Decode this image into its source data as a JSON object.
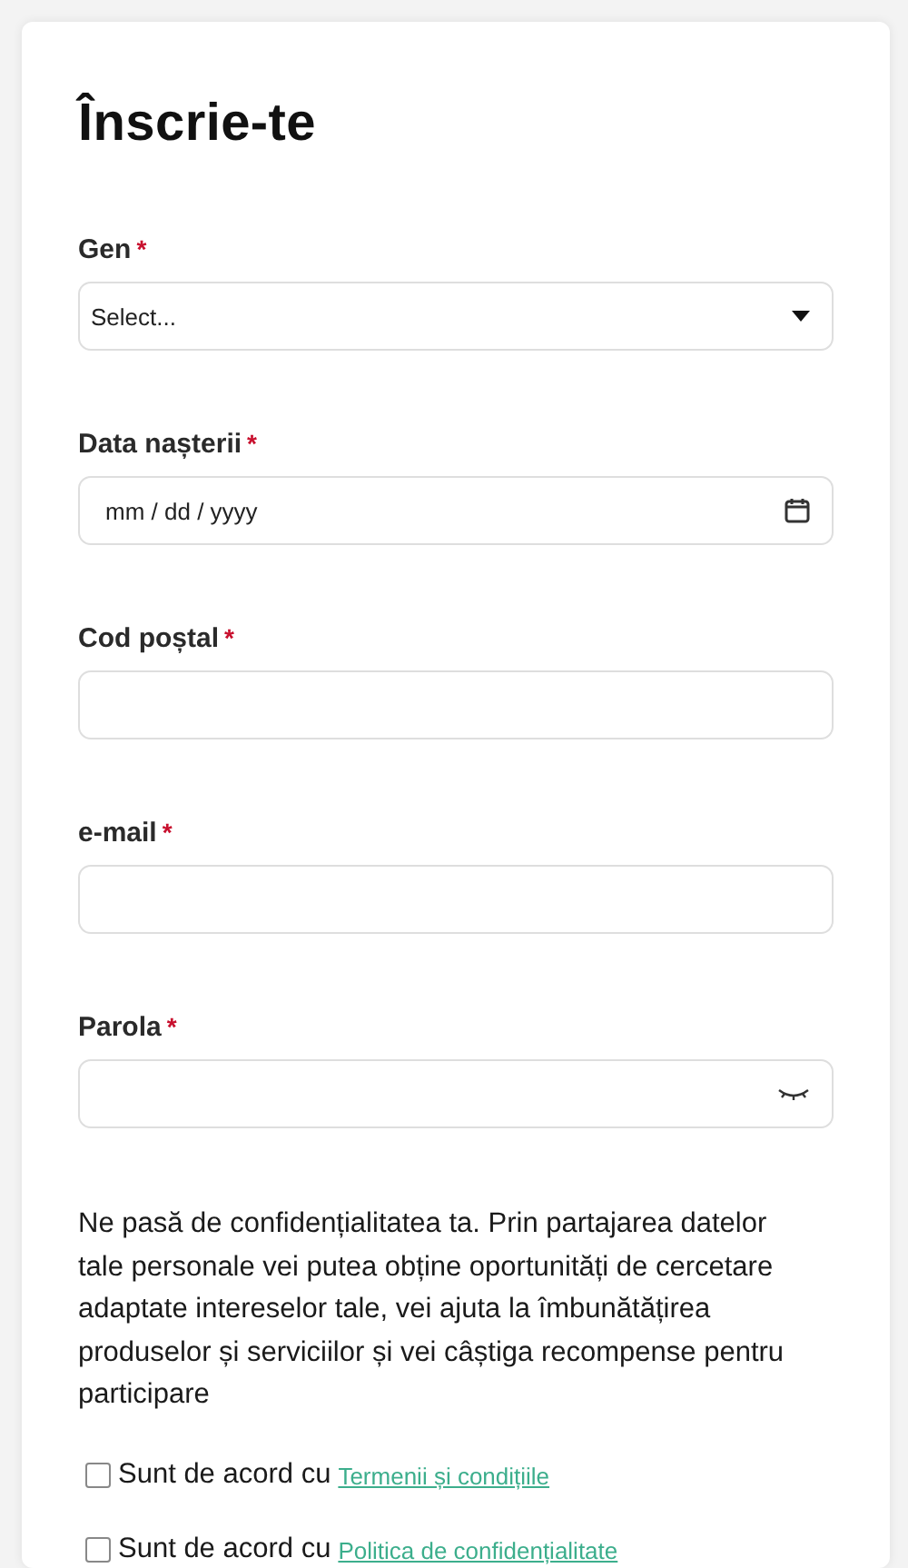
{
  "title": "Înscrie-te",
  "fields": [
    {
      "kind": "select",
      "label": "Gen",
      "required_mark": "*",
      "placeholder": "Select..."
    },
    {
      "kind": "date",
      "label": "Data nașterii",
      "required_mark": "*",
      "placeholder": "mm / dd / yyyy"
    },
    {
      "kind": "text",
      "label": "Cod poștal",
      "required_mark": "*"
    },
    {
      "kind": "text",
      "label": "e-mail",
      "required_mark": "*"
    },
    {
      "kind": "password",
      "label": "Parola",
      "required_mark": "*"
    }
  ],
  "privacy_text": "Ne pasă de confidențialitatea ta. Prin partajarea datelor tale personale vei putea obține oportunități de cercetare adaptate intereselor tale, vei ajuta la îmbunătățirea produselor și serviciilor și vei câștiga recompense pentru participare",
  "agreements": [
    {
      "checked": false,
      "text": "Sunt de acord cu",
      "link": "Termenii și condițiile"
    },
    {
      "checked": false,
      "text": "Sunt de acord cu",
      "link": "Politica de confidențialitate"
    }
  ]
}
